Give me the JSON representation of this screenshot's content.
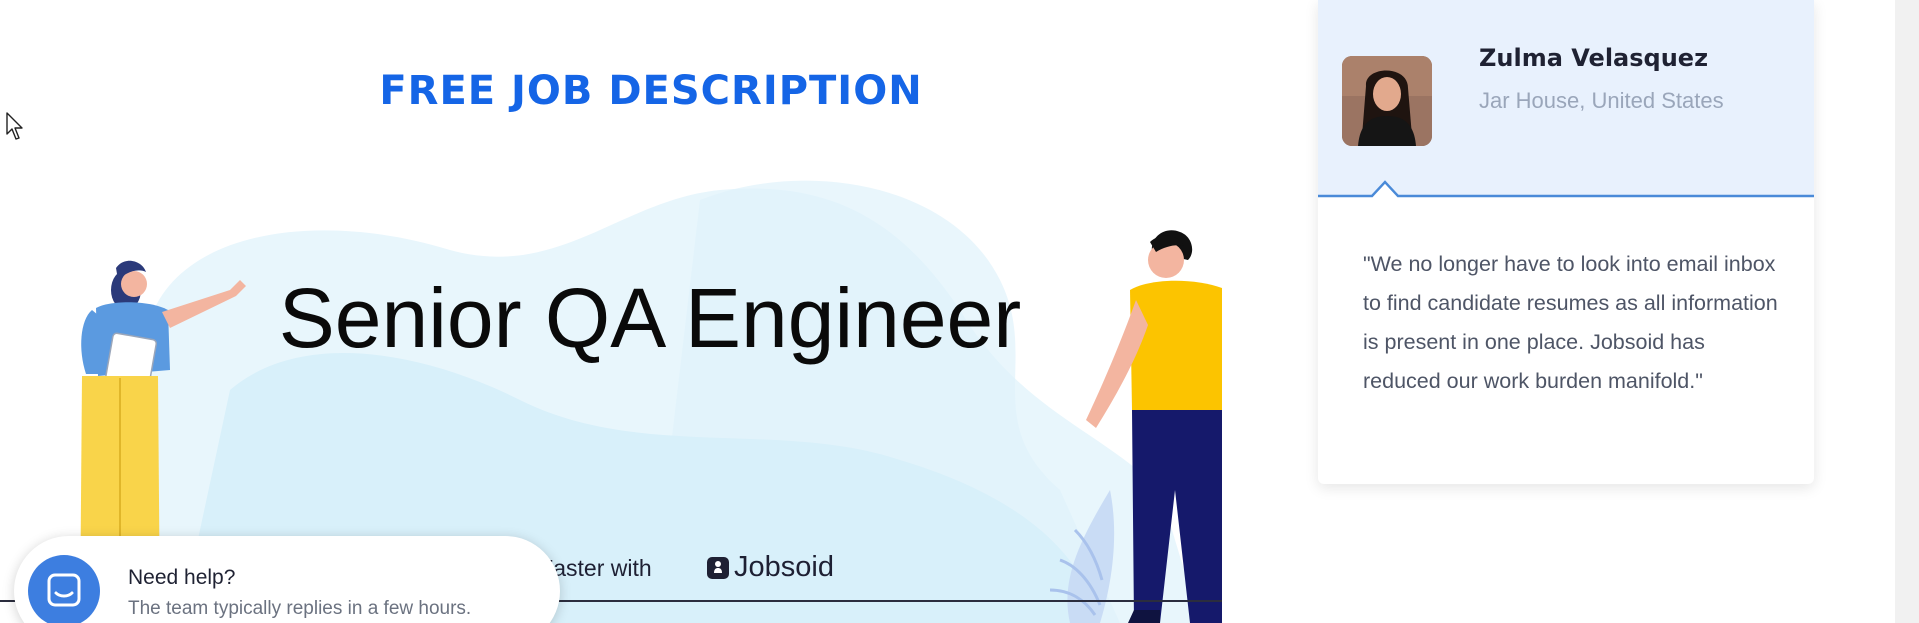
{
  "page": {
    "heading": "FREE JOB DESCRIPTION"
  },
  "banner": {
    "job_title": "Senior QA Engineer",
    "tagline_partial": "r, Faster with",
    "brand_name": "Jobsoid"
  },
  "testimonial": {
    "name": "Zulma Velasquez",
    "location": "Jar House, United States",
    "quote": "\"We no longer have to look into email inbox to find candidate resumes as all information is present in one place. Jobsoid has reduced our work burden manifold.\""
  },
  "chat_widget": {
    "title": "Need help?",
    "subtitle": "The team typically replies in a few hours."
  },
  "colors": {
    "accent": "#1565e6",
    "card_header": "#e8f1fd",
    "chat_icon": "#3d7ee0"
  },
  "icons": [
    "cursor-icon",
    "jobsoid-logo-icon",
    "chat-bubble-icon"
  ]
}
